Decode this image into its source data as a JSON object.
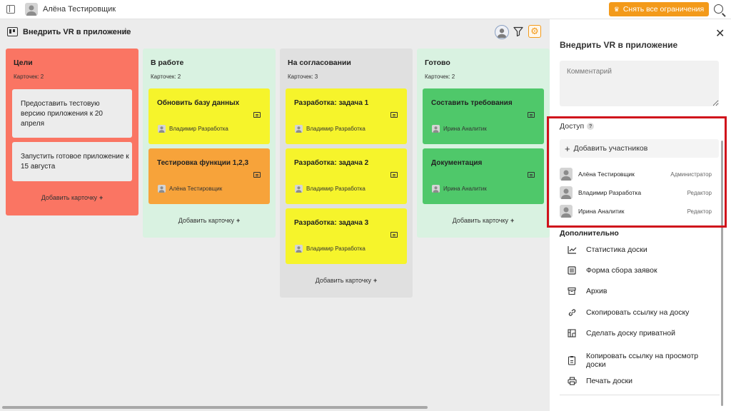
{
  "topbar": {
    "user_name": "Алёна Тестировщик",
    "limits_button": "Снять все ограничения"
  },
  "board": {
    "title": "Внедрить VR в приложение"
  },
  "columns": [
    {
      "title": "Цели",
      "count": "Карточек: 2",
      "color": "#fa7563",
      "add_label": "Добавить карточку",
      "cards": [
        {
          "text": "Предоставить тестовую версию приложения к 20 апреля"
        },
        {
          "text": "Запустить готовое приложение к 15 августа"
        }
      ]
    },
    {
      "title": "В работе",
      "count": "Карточек: 2",
      "color": "#d9f2e1",
      "add_label": "Добавить карточку",
      "cards": [
        {
          "text": "Обновить базу данных",
          "user": "Владимир Разработка",
          "color": "#f6f42b"
        },
        {
          "text": "Тестировка функции 1,2,3",
          "user": "Алёна Тестировщик",
          "color": "#f7a33a"
        }
      ]
    },
    {
      "title": "На согласовании",
      "count": "Карточек: 3",
      "color": "#e0e0e0",
      "add_label": "Добавить карточку",
      "cards": [
        {
          "text": "Разработка: задача 1",
          "user": "Владимир Разработка",
          "color": "#f6f42b"
        },
        {
          "text": "Разработка: задача 2",
          "user": "Владимир Разработка",
          "color": "#f6f42b"
        },
        {
          "text": "Разработка: задача 3",
          "user": "Владимир Разработка",
          "color": "#f6f42b"
        }
      ]
    },
    {
      "title": "Готово",
      "count": "Карточек: 2",
      "color": "#d9f2e1",
      "add_label": "Добавить карточку",
      "cards": [
        {
          "text": "Составить требования",
          "user": "Ирина Аналитик",
          "color": "#4fc86a"
        },
        {
          "text": "Документация",
          "user": "Ирина Аналитик",
          "color": "#4fc86a"
        }
      ]
    }
  ],
  "panel": {
    "title": "Внедрить VR в приложение",
    "comment_placeholder": "Комментарий",
    "access_title": "Доступ",
    "help": "?",
    "add_members": "Добавить участников",
    "members": [
      {
        "name": "Алёна Тестировщик",
        "role": "Администратор"
      },
      {
        "name": "Владимир Разработка",
        "role": "Редактор"
      },
      {
        "name": "Ирина Аналитик",
        "role": "Редактор"
      }
    ],
    "extra_title": "Дополнительно",
    "menu": [
      {
        "label": "Статистика доски",
        "icon": "chart-line-icon"
      },
      {
        "label": "Форма сбора заявок",
        "icon": "form-icon"
      },
      {
        "label": "Архив",
        "icon": "archive-icon"
      },
      {
        "label": "Скопировать ссылку на доску",
        "icon": "link-icon"
      },
      {
        "label": "Сделать доску приватной",
        "icon": "private-board-icon"
      },
      {
        "label": "Копировать ссылку на просмотр доски",
        "icon": "clipboard-link-icon"
      },
      {
        "label": "Печать доски",
        "icon": "printer-icon"
      }
    ]
  },
  "colors": {
    "accent": "#f39a1a",
    "highlight_frame": "#d0121b"
  }
}
